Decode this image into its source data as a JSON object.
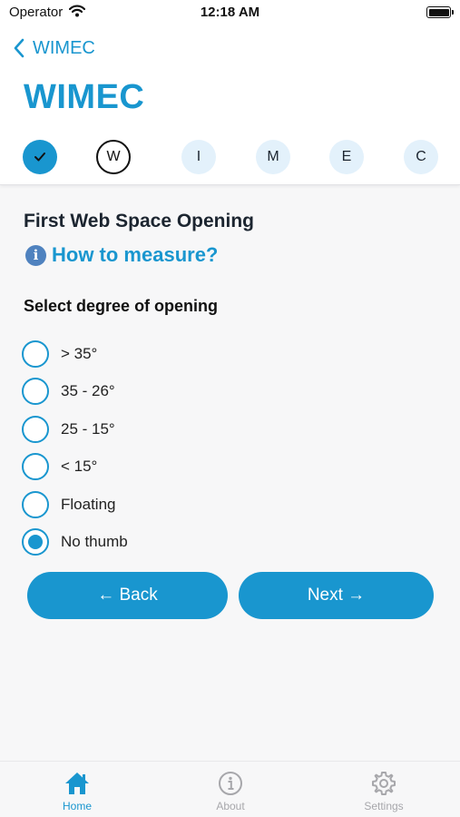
{
  "status_bar": {
    "carrier": "Operator",
    "time": "12:18 AM"
  },
  "nav": {
    "back_label": "WIMEC",
    "large_title": "WIMEC"
  },
  "stepper": {
    "steps": [
      {
        "label": "",
        "state": "done",
        "icon": "checkmark-icon"
      },
      {
        "label": "W",
        "state": "current"
      },
      {
        "label": "I",
        "state": "pending"
      },
      {
        "label": "M",
        "state": "pending"
      },
      {
        "label": "E",
        "state": "pending"
      },
      {
        "label": "C",
        "state": "pending"
      }
    ]
  },
  "content": {
    "section_title": "First Web Space Opening",
    "how_to_label": "How to measure?",
    "question": "Select degree of opening",
    "options": [
      {
        "label": "> 35°",
        "selected": false
      },
      {
        "label": "35 - 26°",
        "selected": false
      },
      {
        "label": "25 - 15°",
        "selected": false
      },
      {
        "label": "< 15°",
        "selected": false
      },
      {
        "label": "Floating",
        "selected": false
      },
      {
        "label": "No thumb",
        "selected": true
      }
    ],
    "back_button": "← Back",
    "next_button": "Next →"
  },
  "tab_bar": {
    "tabs": [
      {
        "label": "Home",
        "icon": "house-icon",
        "active": true
      },
      {
        "label": "About",
        "icon": "info-icon",
        "active": false
      },
      {
        "label": "Settings",
        "icon": "gear-icon",
        "active": false
      }
    ]
  },
  "colors": {
    "accent": "#1996cf",
    "step_pending_bg": "#e3f1fb",
    "inactive_tab": "#a7a7ab",
    "info_badge": "#4f82bf"
  }
}
